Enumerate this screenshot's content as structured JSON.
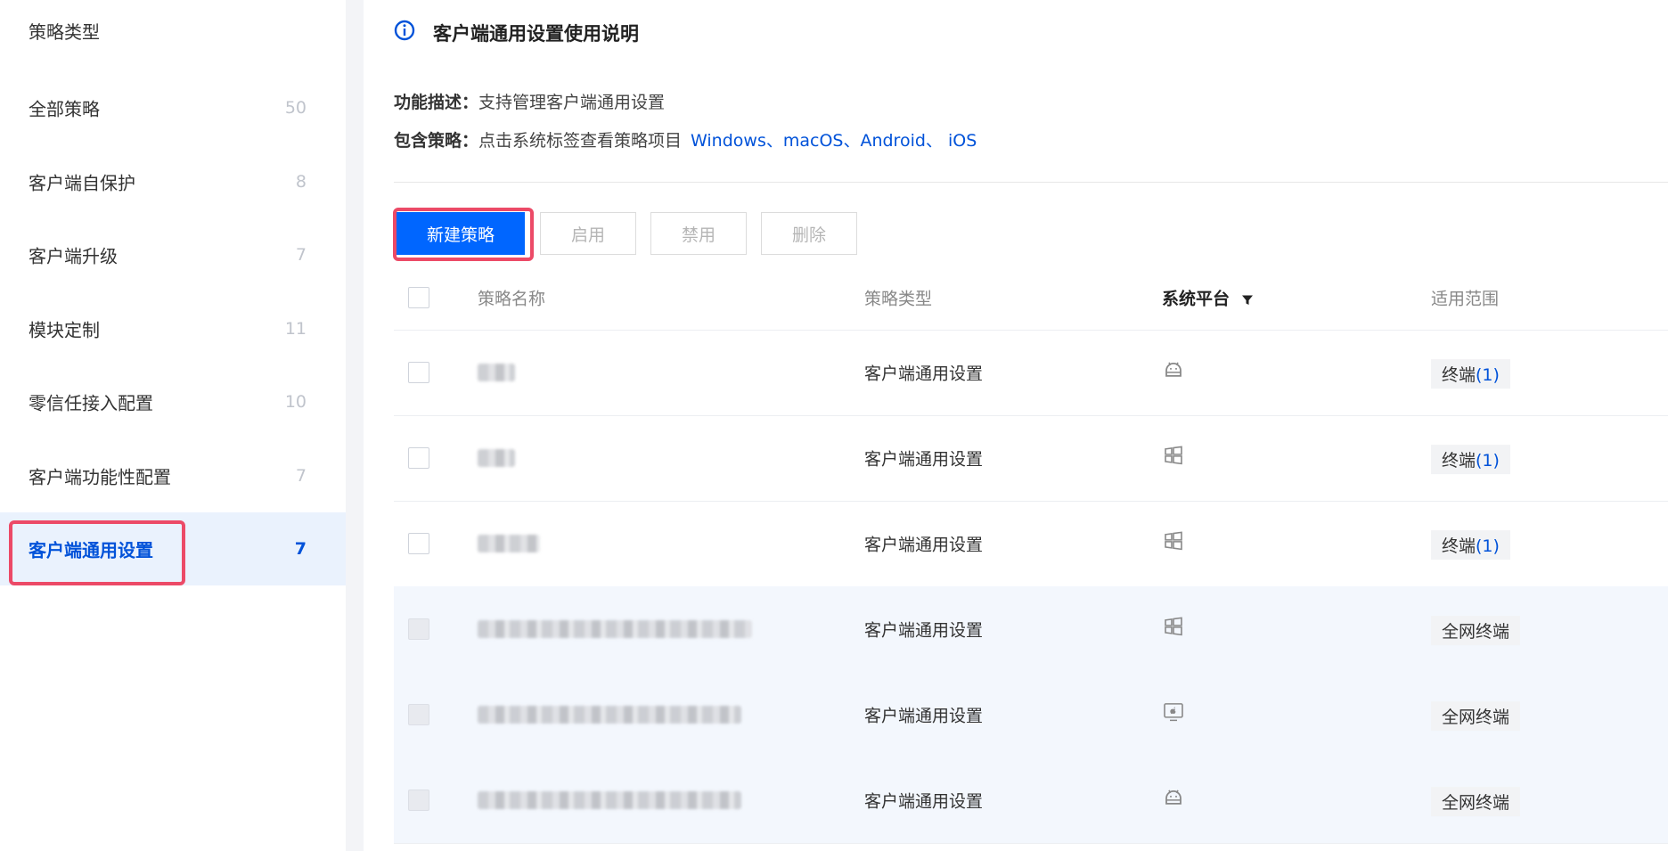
{
  "sidebar": {
    "header": "策略类型",
    "items": [
      {
        "label": "全部策略",
        "count": "50"
      },
      {
        "label": "客户端自保护",
        "count": "8"
      },
      {
        "label": "客户端升级",
        "count": "7"
      },
      {
        "label": "模块定制",
        "count": "11"
      },
      {
        "label": "零信任接入配置",
        "count": "10"
      },
      {
        "label": "客户端功能性配置",
        "count": "7"
      },
      {
        "label": "客户端通用设置",
        "count": "7",
        "active": true
      }
    ]
  },
  "info": {
    "title": "客户端通用设置使用说明",
    "func_label": "功能描述：",
    "func_text": "支持管理客户端通用设置",
    "policy_label": "包含策略：",
    "policy_text": "点击系统标签查看策略项目",
    "policy_links": "Windows、macOS、Android、 iOS"
  },
  "toolbar": {
    "new": "新建策略",
    "enable": "启用",
    "disable": "禁用",
    "delete": "删除"
  },
  "table": {
    "headers": {
      "name": "策略名称",
      "type": "策略类型",
      "platform": "系统平台",
      "scope": "适用范围"
    },
    "rows": [
      {
        "type": "客户端通用设置",
        "platform": "android",
        "scope": "终端",
        "scope_count": "(1)"
      },
      {
        "type": "客户端通用设置",
        "platform": "windows",
        "scope": "终端",
        "scope_count": "(1)"
      },
      {
        "type": "客户端通用设置",
        "platform": "windows",
        "scope": "终端",
        "scope_count": "(1)"
      },
      {
        "type": "客户端通用设置",
        "platform": "windows",
        "scope": "全网终端"
      },
      {
        "type": "客户端通用设置",
        "platform": "macos",
        "scope": "全网终端"
      },
      {
        "type": "客户端通用设置",
        "platform": "android",
        "scope": "全网终端"
      }
    ]
  },
  "colors": {
    "accent": "#0066ff",
    "link": "#0052d9",
    "highlight": "#ec4a67"
  }
}
